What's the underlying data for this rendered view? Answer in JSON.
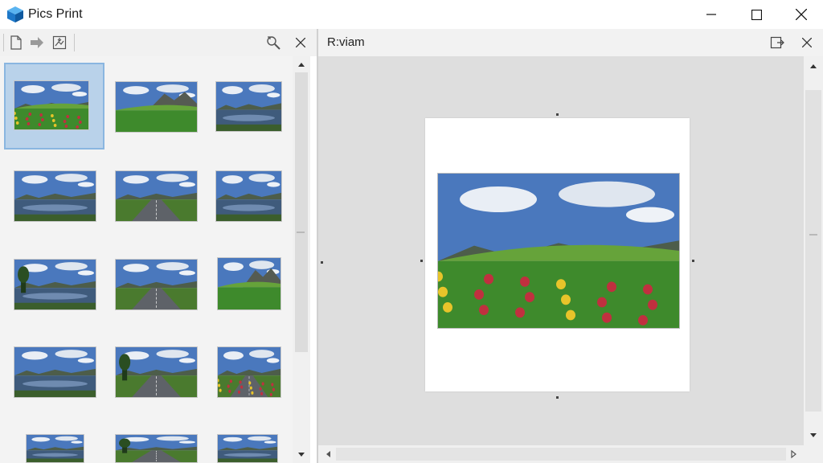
{
  "app": {
    "title": "Pics Print",
    "window_controls": [
      "minimize-icon",
      "maximize-icon",
      "close-icon"
    ]
  },
  "left_toolbar": {
    "icons": [
      "new-document-icon",
      "forward-arrow-icon",
      "image-import-icon",
      "search-refresh-icon",
      "close-icon"
    ]
  },
  "thumbnails": {
    "selected_index": 0,
    "items": [
      {
        "scene": "flower-field"
      },
      {
        "scene": "mountain-meadow"
      },
      {
        "scene": "lake-reflection"
      },
      {
        "scene": "river-sunrise"
      },
      {
        "scene": "road-canal"
      },
      {
        "scene": "river-hills"
      },
      {
        "scene": "tree-river"
      },
      {
        "scene": "road-converging"
      },
      {
        "scene": "mountain-meadow"
      },
      {
        "scene": "river-path"
      },
      {
        "scene": "road-trees"
      },
      {
        "scene": "flower-road"
      },
      {
        "scene": "lake-clouds"
      },
      {
        "scene": "road-trees"
      },
      {
        "scene": "lake-reflection"
      }
    ]
  },
  "preview": {
    "title": "R:viam",
    "icons": [
      "export-icon",
      "close-icon"
    ]
  },
  "colors": {
    "selection": "#b9d2ea",
    "sky": "#3f6fb5",
    "grass": "#3e8a2c"
  }
}
